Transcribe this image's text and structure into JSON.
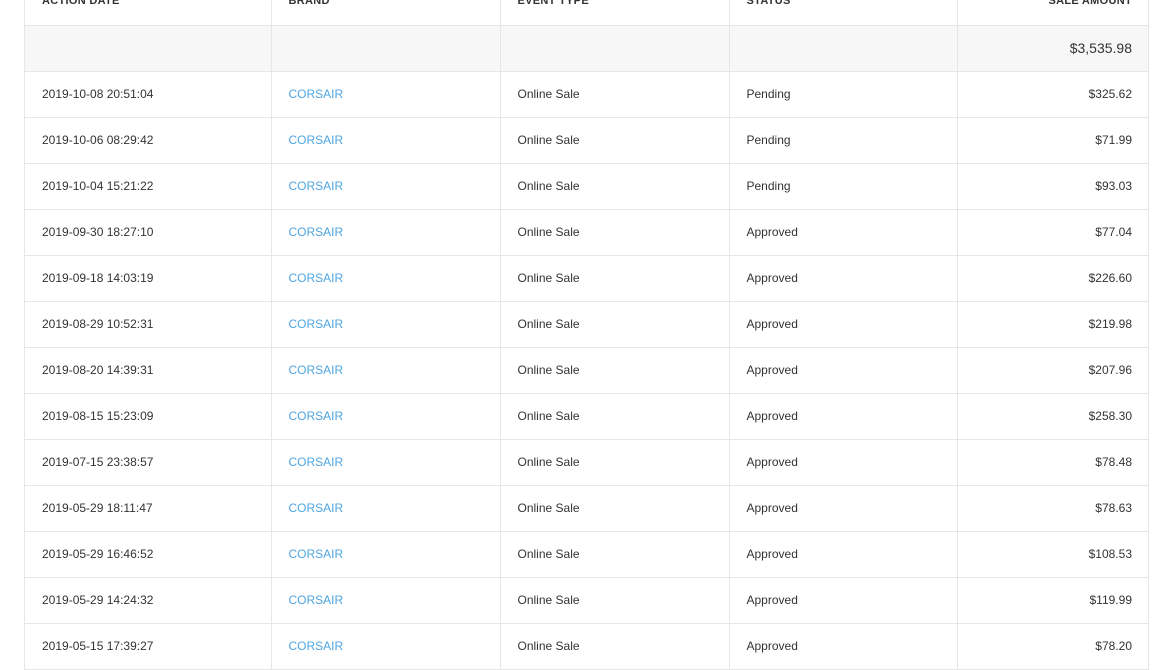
{
  "table": {
    "headers": {
      "action_date": "ACTION DATE",
      "brand": "BRAND",
      "event_type": "EVENT TYPE",
      "status": "STATUS",
      "sale_amount": "SALE AMOUNT"
    },
    "total": "$3,535.98",
    "rows": [
      {
        "date": "2019-10-08 20:51:04",
        "brand": "CORSAIR",
        "event": "Online Sale",
        "status": "Pending",
        "amount": "$325.62"
      },
      {
        "date": "2019-10-06 08:29:42",
        "brand": "CORSAIR",
        "event": "Online Sale",
        "status": "Pending",
        "amount": "$71.99"
      },
      {
        "date": "2019-10-04 15:21:22",
        "brand": "CORSAIR",
        "event": "Online Sale",
        "status": "Pending",
        "amount": "$93.03"
      },
      {
        "date": "2019-09-30 18:27:10",
        "brand": "CORSAIR",
        "event": "Online Sale",
        "status": "Approved",
        "amount": "$77.04"
      },
      {
        "date": "2019-09-18 14:03:19",
        "brand": "CORSAIR",
        "event": "Online Sale",
        "status": "Approved",
        "amount": "$226.60"
      },
      {
        "date": "2019-08-29 10:52:31",
        "brand": "CORSAIR",
        "event": "Online Sale",
        "status": "Approved",
        "amount": "$219.98"
      },
      {
        "date": "2019-08-20 14:39:31",
        "brand": "CORSAIR",
        "event": "Online Sale",
        "status": "Approved",
        "amount": "$207.96"
      },
      {
        "date": "2019-08-15 15:23:09",
        "brand": "CORSAIR",
        "event": "Online Sale",
        "status": "Approved",
        "amount": "$258.30"
      },
      {
        "date": "2019-07-15 23:38:57",
        "brand": "CORSAIR",
        "event": "Online Sale",
        "status": "Approved",
        "amount": "$78.48"
      },
      {
        "date": "2019-05-29 18:11:47",
        "brand": "CORSAIR",
        "event": "Online Sale",
        "status": "Approved",
        "amount": "$78.63"
      },
      {
        "date": "2019-05-29 16:46:52",
        "brand": "CORSAIR",
        "event": "Online Sale",
        "status": "Approved",
        "amount": "$108.53"
      },
      {
        "date": "2019-05-29 14:24:32",
        "brand": "CORSAIR",
        "event": "Online Sale",
        "status": "Approved",
        "amount": "$119.99"
      },
      {
        "date": "2019-05-15 17:39:27",
        "brand": "CORSAIR",
        "event": "Online Sale",
        "status": "Approved",
        "amount": "$78.20"
      }
    ]
  },
  "colors": {
    "link": "#4ea5e0",
    "total_row_bg": "#f7f7f7",
    "border": "#e6e6e6"
  }
}
